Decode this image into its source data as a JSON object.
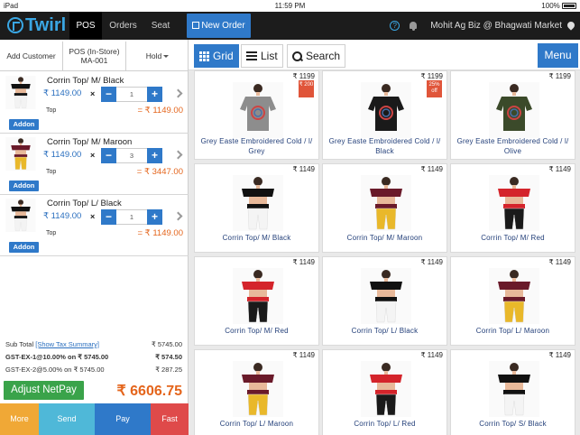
{
  "status_bar": {
    "device": "iPad",
    "time": "11:59 PM",
    "battery": "100%"
  },
  "nav": {
    "logo": "Twirl",
    "tabs": [
      "POS",
      "Orders",
      "Seat"
    ],
    "new_order": "New Order",
    "help": "?",
    "store": "Mohit Ag Biz @ Bhagwati Market"
  },
  "cart": {
    "tabs": {
      "add_customer": "Add Customer",
      "pos_line1": "POS (In-Store)",
      "pos_line2": "MA-001",
      "hold": "Hold"
    },
    "items": [
      {
        "name": "Corrin Top/ M/ Black",
        "price": "₹ 1149.00",
        "mult": "×",
        "qty": "1",
        "variant": "Top",
        "total": "= ₹ 1149.00",
        "addon": "Addon",
        "colors": {
          "top": "#111111",
          "bottom": "#f3f3f3"
        }
      },
      {
        "name": "Corrin Top/ M/ Maroon",
        "price": "₹ 1149.00",
        "mult": "×",
        "qty": "3",
        "variant": "Top",
        "total": "= ₹ 3447.00",
        "addon": "Addon",
        "colors": {
          "top": "#6a1a2a",
          "bottom": "#e9b82a"
        }
      },
      {
        "name": "Corrin Top/ L/ Black",
        "price": "₹ 1149.00",
        "mult": "×",
        "qty": "1",
        "variant": "Top",
        "total": "= ₹ 1149.00",
        "addon": "Addon",
        "colors": {
          "top": "#111111",
          "bottom": "#f3f3f3"
        }
      }
    ],
    "summary": {
      "subtotal_label": "Sub Total",
      "tax_link": "[Show Tax Summary]",
      "subtotal": "₹ 5745.00",
      "tax1_label": "GST-EX-1@10.00% on ₹ 5745.00",
      "tax1": "₹ 574.50",
      "tax2_label": "GST-EX-2@5.00% on ₹ 5745.00",
      "tax2": "₹ 287.25"
    },
    "adjust_netpay": "Adjust NetPay",
    "net_pay": "₹ 6606.75",
    "actions": [
      {
        "label": "More",
        "color": "#f0a836"
      },
      {
        "label": "Send",
        "color": "#4fb8d8"
      },
      {
        "label": "Pay",
        "color": "#2f79c9"
      },
      {
        "label": "Fast",
        "color": "#df4a4a"
      }
    ]
  },
  "toolbar": {
    "grid": "Grid",
    "list": "List",
    "search": "Search",
    "menu": "Menu"
  },
  "products": [
    {
      "price": "₹ 1199",
      "name": "Grey Easte Embroidered Cold / l/ Grey",
      "badge": "₹ 200",
      "badge_color": "#e0553a",
      "kind": "tee",
      "top": "#8d8d8d",
      "bottom": "#ffffff"
    },
    {
      "price": "₹ 1199",
      "name": "Grey Easte Embroidered Cold / l/ Black",
      "badge": "25% off",
      "badge_color": "#e0553a",
      "kind": "tee",
      "top": "#1a1a1a",
      "bottom": "#ffffff"
    },
    {
      "price": "₹ 1199",
      "name": "Grey Easte Embroidered Cold / l/ Olive",
      "badge": "",
      "badge_color": "",
      "kind": "tee",
      "top": "#3b4a2a",
      "bottom": "#ffffff"
    },
    {
      "price": "₹ 1149",
      "name": "Corrin Top/ M/ Black",
      "kind": "off",
      "top": "#111111",
      "bottom": "#f4f4f4"
    },
    {
      "price": "₹ 1149",
      "name": "Corrin Top/ M/ Maroon",
      "kind": "off",
      "top": "#6a1a2a",
      "bottom": "#e9b82a"
    },
    {
      "price": "₹ 1149",
      "name": "Corrin Top/ M/ Red",
      "kind": "off",
      "top": "#d4242b",
      "bottom": "#1a1a1a"
    },
    {
      "price": "₹ 1149",
      "name": "Corrin Top/ M/ Red",
      "kind": "off",
      "top": "#d4242b",
      "bottom": "#1a1a1a"
    },
    {
      "price": "₹ 1149",
      "name": "Corrin Top/ L/ Black",
      "kind": "off",
      "top": "#111111",
      "bottom": "#f4f4f4"
    },
    {
      "price": "₹ 1149",
      "name": "Corrin Top/ L/ Maroon",
      "kind": "off",
      "top": "#6a1a2a",
      "bottom": "#e9b82a"
    },
    {
      "price": "₹ 1149",
      "name": "Corrin Top/ L/ Maroon",
      "kind": "off",
      "top": "#6a1a2a",
      "bottom": "#e9b82a"
    },
    {
      "price": "₹ 1149",
      "name": "Corrin Top/ L/ Red",
      "kind": "off",
      "top": "#d4242b",
      "bottom": "#1a1a1a"
    },
    {
      "price": "₹ 1149",
      "name": "Corrin Top/ S/ Black",
      "kind": "off",
      "top": "#111111",
      "bottom": "#f4f4f4"
    }
  ]
}
